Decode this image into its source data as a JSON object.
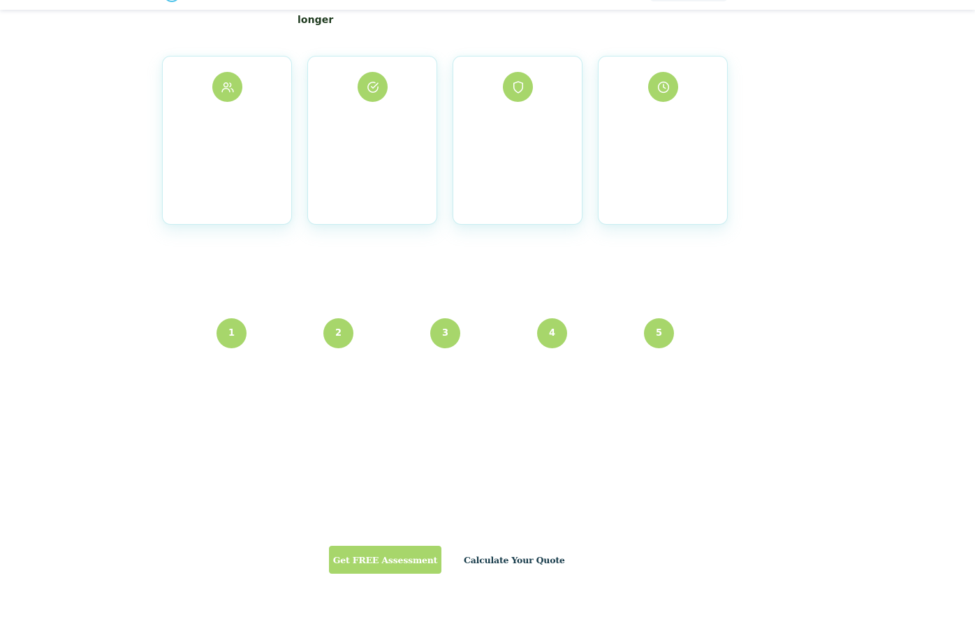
{
  "heading_fragment": "longer",
  "feature_cards": [
    {
      "icon": "users-icon"
    },
    {
      "icon": "check-circle-icon"
    },
    {
      "icon": "shield-icon"
    },
    {
      "icon": "clock-icon"
    }
  ],
  "steps": [
    "1",
    "2",
    "3",
    "4",
    "5"
  ],
  "cta": {
    "primary_label": "Get FREE Assessment",
    "secondary_label": "Calculate Your Quote"
  },
  "colors": {
    "accent_green": "#a7d66b",
    "card_border": "#c9eef2",
    "heading_text": "#1e3a1e",
    "link_text": "#173b4a",
    "logo_blue": "#4ec3ea"
  }
}
